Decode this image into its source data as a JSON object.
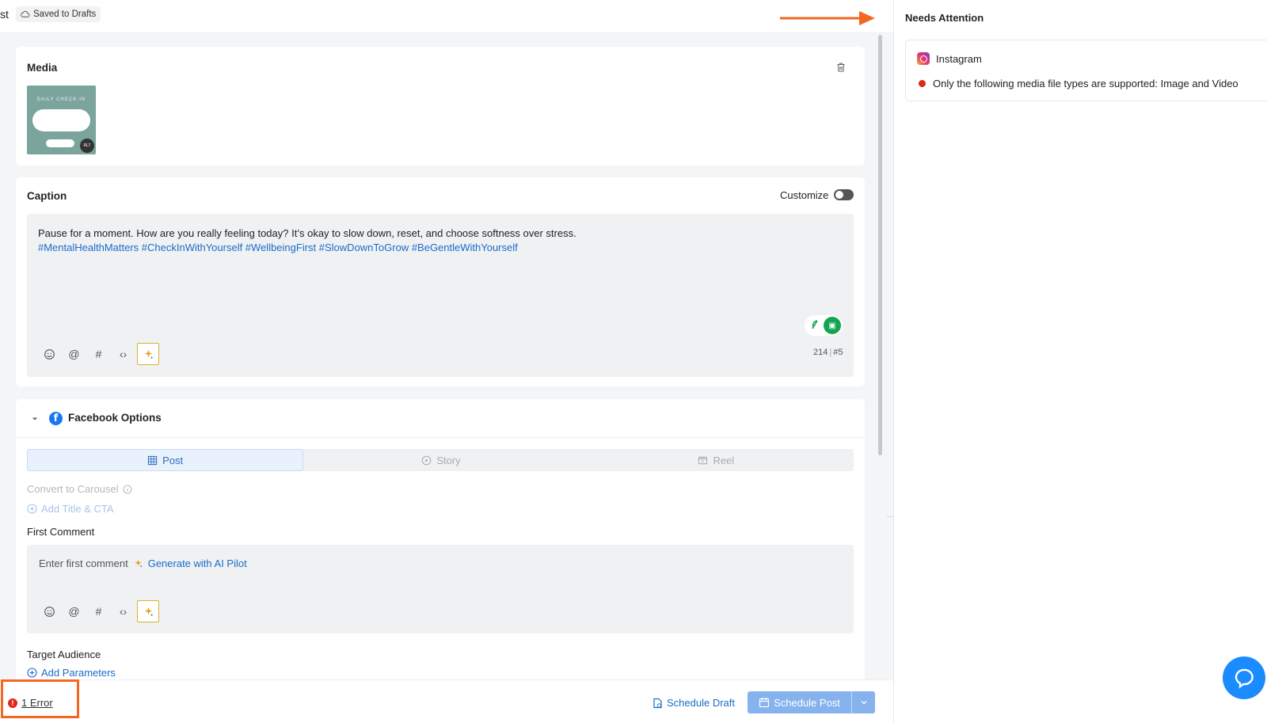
{
  "topbar": {
    "cut_title": "st",
    "saved_label": "Saved to Drafts"
  },
  "media": {
    "title": "Media",
    "thumb_caption": "DAILY CHECK-IN",
    "thumb_badge": "RLT"
  },
  "caption": {
    "title": "Caption",
    "customize_label": "Customize",
    "text": "Pause for a moment. How are you really feeling today? It’s okay to slow down, reset, and choose softness over stress.",
    "hashtags": "#MentalHealthMatters #CheckInWithYourself #WellbeingFirst #SlowDownToGrow #BeGentleWithYourself",
    "char_count": "214",
    "hashtag_count": "#5"
  },
  "facebook": {
    "title": "Facebook Options",
    "tabs": [
      {
        "label": "Post",
        "icon": "grid-icon",
        "active": true
      },
      {
        "label": "Story",
        "icon": "play-circle-icon",
        "active": false
      },
      {
        "label": "Reel",
        "icon": "reel-icon",
        "active": false
      }
    ],
    "convert_label": "Convert to Carousel",
    "add_title_label": "Add Title & CTA",
    "first_comment_label": "First Comment",
    "first_comment_placeholder": "Enter first comment",
    "generate_label": "Generate with AI Pilot",
    "target_audience_label": "Target Audience",
    "add_parameters_label": "Add Parameters"
  },
  "footer": {
    "error_label": "1 Error",
    "schedule_draft_label": "Schedule Draft",
    "schedule_post_label": "Schedule Post"
  },
  "panel": {
    "title": "Needs Attention",
    "platform": "Instagram",
    "error_message": "Only the following media file types are supported: Image and Video"
  },
  "colors": {
    "accent": "#1a6cc9",
    "error": "#e0271a",
    "highlight": "#f26722",
    "schedule_button": "#86b2ee",
    "chat_button": "#1a8cff"
  }
}
